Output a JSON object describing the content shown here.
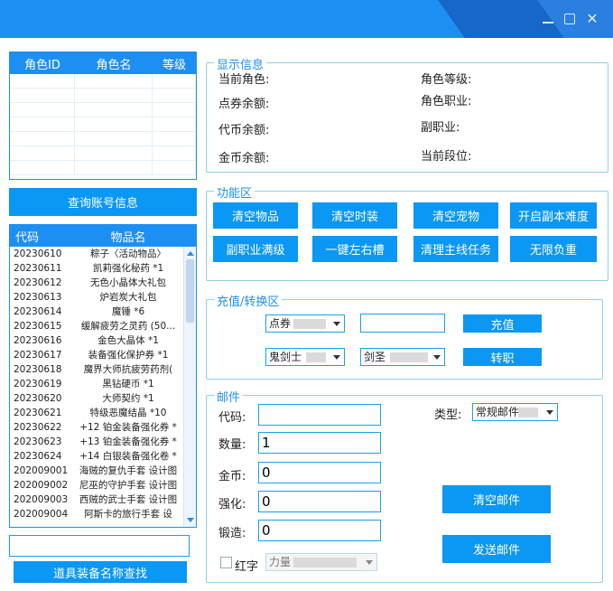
{
  "window": {
    "min_icon": "minimize-icon",
    "max_icon": "maximize-icon",
    "close_icon": "close-icon"
  },
  "role_table": {
    "headers": [
      "角色ID",
      "角色名",
      "等级"
    ]
  },
  "query_button": "查询账号信息",
  "item_table": {
    "headers": [
      "代码",
      "物品名"
    ],
    "rows": [
      {
        "code": "20230610",
        "name": "粽子〈活动物品〉"
      },
      {
        "code": "20230611",
        "name": "凯莉强化秘药 *1"
      },
      {
        "code": "20230612",
        "name": "无色小晶体大礼包"
      },
      {
        "code": "20230613",
        "name": "炉岩炭大礼包"
      },
      {
        "code": "20230614",
        "name": "魔锤 *6"
      },
      {
        "code": "20230615",
        "name": "缓解疲劳之灵药 (50..."
      },
      {
        "code": "20230616",
        "name": "金色大晶体 *1"
      },
      {
        "code": "20230617",
        "name": "装备强化保护券 *1"
      },
      {
        "code": "20230618",
        "name": "魔界大师抗疲劳药剂("
      },
      {
        "code": "20230619",
        "name": "黑钻硬币 *1"
      },
      {
        "code": "20230620",
        "name": "大师契约 *1"
      },
      {
        "code": "20230621",
        "name": "特级恶魔结晶 *10"
      },
      {
        "code": "20230622",
        "name": "+12 铂金装备强化券 *"
      },
      {
        "code": "20230623",
        "name": "+13 铂金装备强化券 *"
      },
      {
        "code": "20230624",
        "name": "+14 白银装备强化卷 *"
      },
      {
        "code": "202009001",
        "name": "海贼的复仇手套 设计图"
      },
      {
        "code": "202009002",
        "name": "尼巫的守护手套 设计图"
      },
      {
        "code": "202009003",
        "name": "西贼的武士手套 设计图"
      },
      {
        "code": "202009004",
        "name": "阿斯卡的旅行手套 设"
      }
    ]
  },
  "search_input": {
    "value": ""
  },
  "search_button": "道具装备名称查找",
  "display_group": {
    "title": "显示信息",
    "current_role": "当前角色:",
    "points_balance": "点券余额:",
    "token_balance": "代币余额:",
    "gold_balance": "金币余额:",
    "role_level": "角色等级:",
    "role_job": "角色职业:",
    "sub_job": "副职业:",
    "current_tier": "当前段位:"
  },
  "function_group": {
    "title": "功能区",
    "buttons": [
      "清空物品",
      "清空时装",
      "清空宠物",
      "开启副本难度",
      "副职业满级",
      "一键左右槽",
      "清理主线任务",
      "无限负重"
    ]
  },
  "recharge_group": {
    "title": "充值/转换区",
    "currency_select": "点券",
    "amount_value": "",
    "recharge_button": "充值",
    "class_select": "鬼剑士",
    "job_select": "剑圣",
    "change_job_button": "转职"
  },
  "mail_group": {
    "title": "邮件",
    "code_label": "代码:",
    "code_value": "",
    "qty_label": "数量:",
    "qty_value": "1",
    "gold_label": "金币:",
    "gold_value": "0",
    "enhance_label": "强化:",
    "enhance_value": "0",
    "forge_label": "锻造:",
    "forge_value": "0",
    "type_label": "类型:",
    "type_select": "常规邮件",
    "red_char_label": "红字",
    "red_char_select": "力量",
    "clear_button": "清空邮件",
    "send_button": "发送邮件"
  },
  "colors": {
    "accent": "#1e8ff2",
    "button": "#0b97f4",
    "group_border": "#8fd0f0"
  }
}
